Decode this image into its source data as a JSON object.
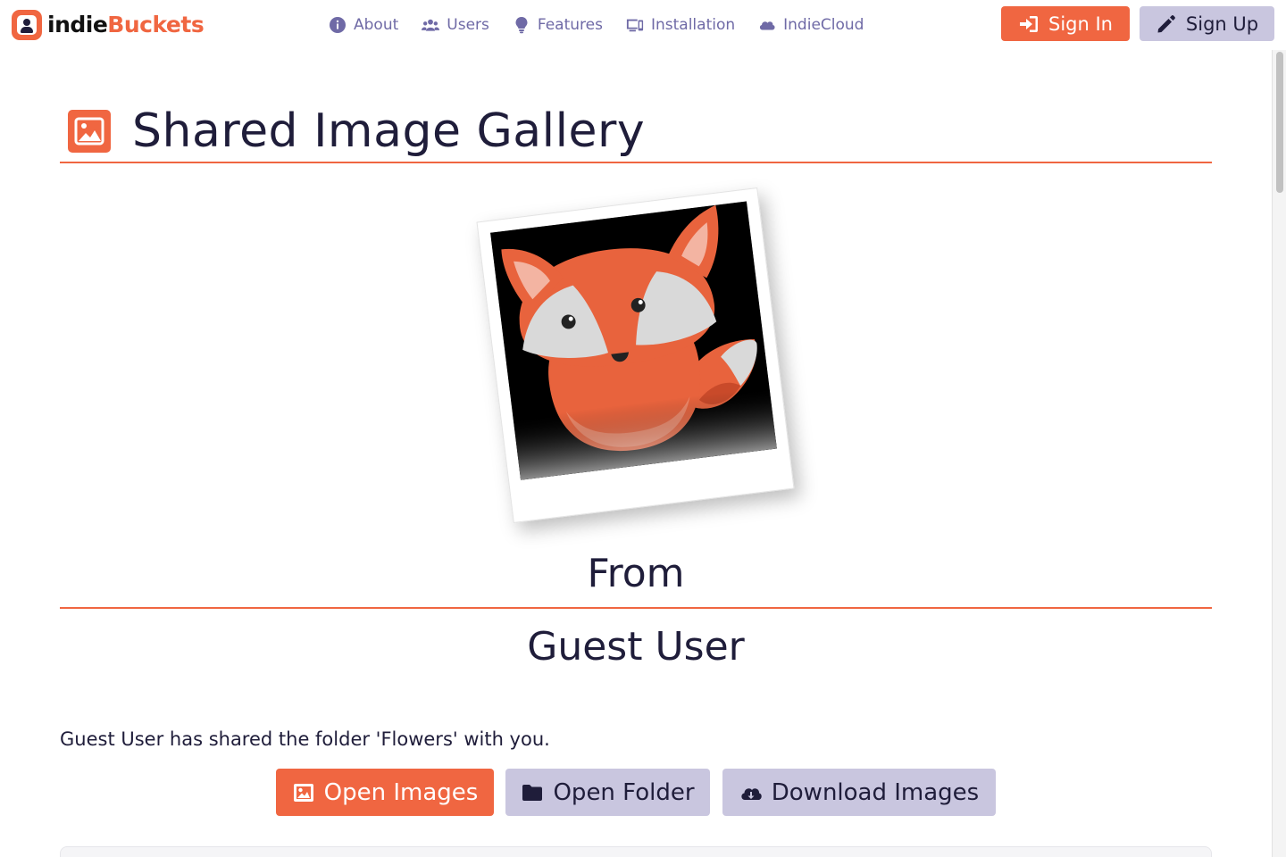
{
  "brand": {
    "name_part1": "indie",
    "name_part2": "Buckets",
    "accent": "#f06641"
  },
  "nav": {
    "items": [
      {
        "label": "About",
        "icon": "info-circle-icon"
      },
      {
        "label": "Users",
        "icon": "users-icon"
      },
      {
        "label": "Features",
        "icon": "lightbulb-icon"
      },
      {
        "label": "Installation",
        "icon": "devices-icon"
      },
      {
        "label": "IndieCloud",
        "icon": "cloud-icon"
      }
    ],
    "sign_in": "Sign In",
    "sign_up": "Sign Up"
  },
  "main": {
    "title": "Shared Image Gallery",
    "from_label": "From",
    "user_name": "Guest User",
    "share_message": "Guest User has shared the folder 'Flowers' with you.",
    "actions": {
      "open_images": "Open Images",
      "open_folder": "Open Folder",
      "download_images": "Download Images"
    }
  },
  "colors": {
    "primary": "#f06641",
    "secondary": "#c9c6df",
    "text": "#1f1d3a",
    "nav_text": "#6f6aa6"
  }
}
